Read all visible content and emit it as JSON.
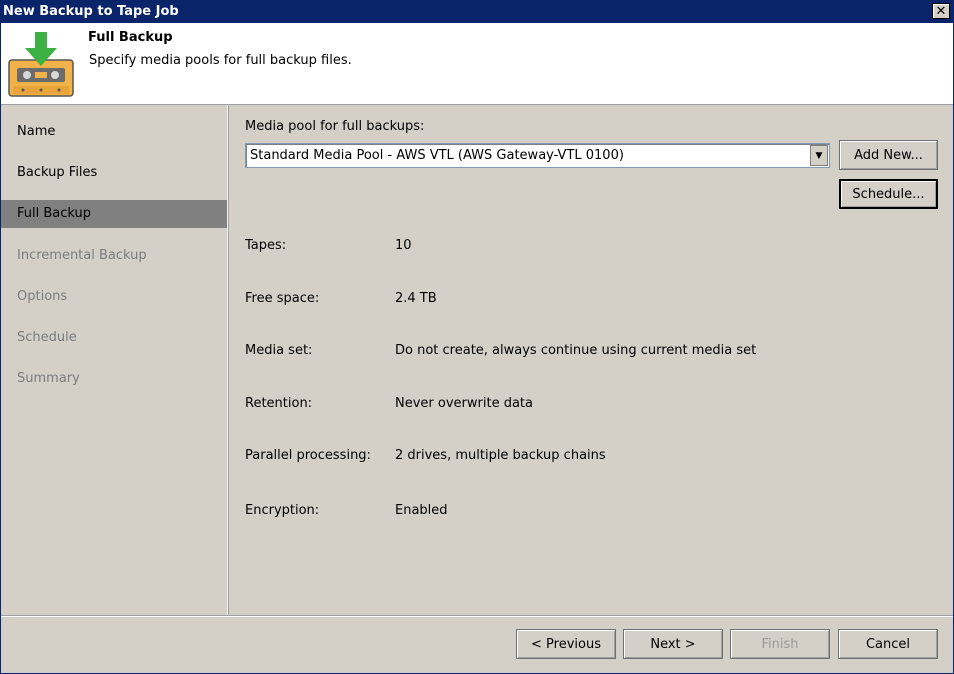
{
  "window": {
    "title": "New Backup to Tape Job",
    "close_glyph": "✕"
  },
  "header": {
    "title": "Full Backup",
    "subtitle": "Specify media pools for full backup files.",
    "icon": "tape-download-icon"
  },
  "sidebar": {
    "items": [
      {
        "label": "Name",
        "state": "enabled"
      },
      {
        "label": "Backup Files",
        "state": "enabled"
      },
      {
        "label": "Full Backup",
        "state": "active"
      },
      {
        "label": "Incremental Backup",
        "state": "disabled"
      },
      {
        "label": "Options",
        "state": "disabled"
      },
      {
        "label": "Schedule",
        "state": "disabled"
      },
      {
        "label": "Summary",
        "state": "disabled"
      }
    ]
  },
  "main": {
    "pool_label": "Media pool for full backups:",
    "pool_selected": "Standard Media Pool - AWS VTL (AWS Gateway-VTL 0100)",
    "add_new_label": "Add New...",
    "schedule_label": "Schedule...",
    "fields": [
      {
        "label": "Tapes:",
        "value": "10"
      },
      {
        "label": "Free space:",
        "value": "2.4 TB"
      },
      {
        "label": "Media set:",
        "value": "Do not create, always continue using current media set"
      },
      {
        "label": "Retention:",
        "value": "Never overwrite data"
      },
      {
        "label": "Parallel processing:",
        "value": "2 drives, multiple backup chains"
      },
      {
        "label": "Encryption:",
        "value": "Enabled"
      }
    ]
  },
  "footer": {
    "previous_label": "< Previous",
    "next_label": "Next >",
    "finish_label": "Finish",
    "cancel_label": "Cancel"
  },
  "colors": {
    "titlebar": "#0a246a",
    "dialog_bg": "#d4d0c8",
    "active_nav": "#808080",
    "icon_arrow": "#3cb043",
    "icon_tape": "#f0b040"
  }
}
